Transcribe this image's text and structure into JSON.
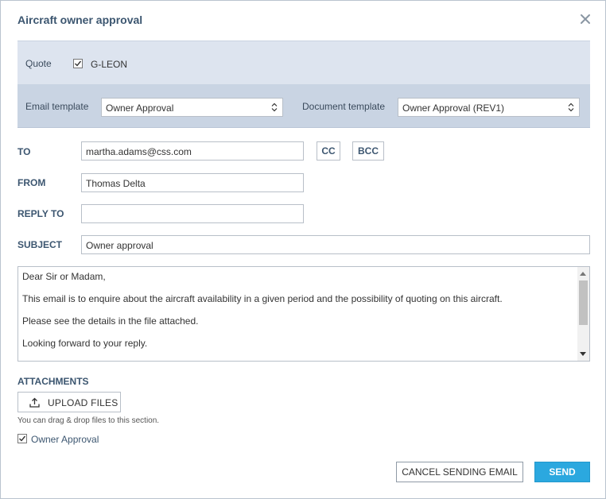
{
  "dialog": {
    "title": "Aircraft owner approval",
    "close_icon": "close-icon"
  },
  "quote": {
    "label": "Quote",
    "aircraft": "G-LEON",
    "checked": true
  },
  "templates": {
    "email_label": "Email template",
    "email_value": "Owner Approval",
    "document_label": "Document template",
    "document_value": "Owner Approval (REV1)"
  },
  "fields": {
    "to_label": "TO",
    "to_value": "martha.adams@css.com",
    "cc_label": "CC",
    "bcc_label": "BCC",
    "from_label": "FROM",
    "from_value": "Thomas Delta",
    "reply_to_label": "REPLY TO",
    "reply_to_value": "",
    "subject_label": "SUBJECT",
    "subject_value": "Owner approval"
  },
  "body": {
    "lines": [
      "Dear Sir or Madam,",
      "This email is to enquire about the aircraft availability in a given period and the possibility of quoting on this aircraft.",
      "Please see the details in the file attached.",
      "Looking forward to your reply."
    ]
  },
  "attachments": {
    "heading": "ATTACHMENTS",
    "upload_label": "UPLOAD FILES",
    "upload_icon": "upload-icon",
    "hint": "You can drag & drop files to this section.",
    "items": [
      {
        "label": "Owner Approval",
        "checked": true
      }
    ]
  },
  "actions": {
    "cancel_label": "CANCEL SENDING EMAIL",
    "send_label": "SEND"
  },
  "colors": {
    "title": "#3c5670",
    "quote_band": "#dde4ef",
    "template_band": "#c9d4e3",
    "send_button": "#2ba8df"
  }
}
